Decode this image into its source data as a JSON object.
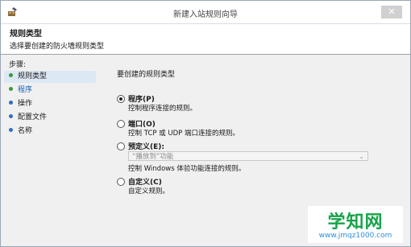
{
  "window": {
    "title": "新建入站规则向导",
    "close_glyph": "✕"
  },
  "header": {
    "title": "规则类型",
    "subtitle": "选择要创建的防火墙规则类型"
  },
  "sidebar": {
    "steps_label": "步骤:",
    "items": [
      {
        "label": "规则类型",
        "dot_color": "#3a9a3a"
      },
      {
        "label": "程序",
        "dot_color": "#3a9a3a"
      },
      {
        "label": "操作",
        "dot_color": "#2f6fc2"
      },
      {
        "label": "配置文件",
        "dot_color": "#2f6fc2"
      },
      {
        "label": "名称",
        "dot_color": "#2f6fc2"
      }
    ]
  },
  "content": {
    "prompt": "要创建的规则类型",
    "options": [
      {
        "label": "程序(P)",
        "desc": "控制程序连接的规则。",
        "checked": true
      },
      {
        "label": "端口(O)",
        "desc": "控制 TCP 或 UDP 端口连接的规则。",
        "checked": false
      },
      {
        "label": "预定义(E):",
        "desc": "控制 Windows 体验功能连接的规则。",
        "checked": false
      },
      {
        "label": "自定义(C)",
        "desc": "自定义规则。",
        "checked": false
      }
    ],
    "predefined_select": {
      "value": "“播放到”功能",
      "caret": "⌄"
    }
  },
  "watermark": {
    "main": "学知网",
    "url": "www.jmqz1000.com"
  }
}
